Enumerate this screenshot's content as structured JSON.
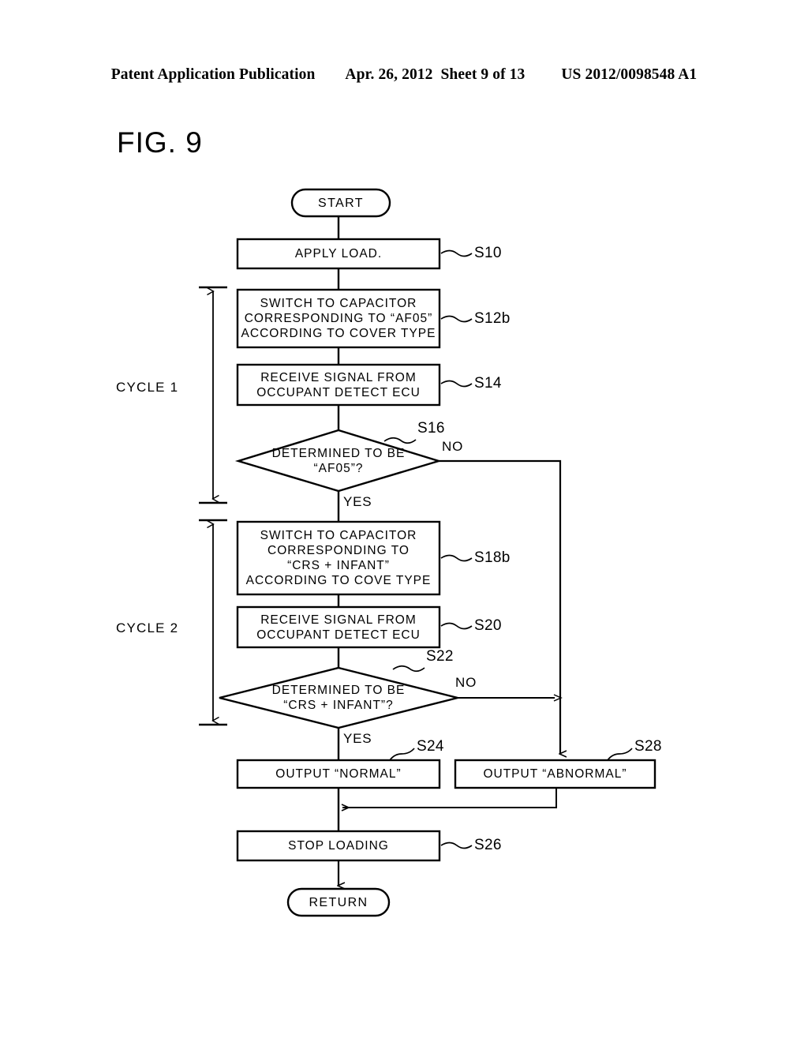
{
  "header": {
    "left": "Patent Application Publication",
    "middle": "Apr. 26, 2012  Sheet 9 of 13",
    "right": "US 2012/0098548 A1"
  },
  "figure": {
    "label": "FIG. 9",
    "type": "flowchart"
  },
  "diagram": {
    "nodes": [
      {
        "id": "start",
        "shape": "terminator",
        "text": "START",
        "ref": ""
      },
      {
        "id": "s10",
        "shape": "process",
        "text": "APPLY LOAD.",
        "ref": "S10"
      },
      {
        "id": "s12b",
        "shape": "process",
        "text": "SWITCH TO CAPACITOR\nCORRESPONDING TO “AF05”\nACCORDING TO COVER TYPE",
        "ref": "S12b"
      },
      {
        "id": "s14",
        "shape": "process",
        "text": "RECEIVE SIGNAL FROM\nOCCUPANT DETECT ECU",
        "ref": "S14"
      },
      {
        "id": "s16",
        "shape": "decision",
        "text": "DETERMINED TO BE\n“AF05”?",
        "ref": "S16"
      },
      {
        "id": "s18b",
        "shape": "process",
        "text": "SWITCH TO CAPACITOR\nCORRESPONDING TO\n“CRS + INFANT”\nACCORDING TO COVE TYPE",
        "ref": "S18b"
      },
      {
        "id": "s20",
        "shape": "process",
        "text": "RECEIVE SIGNAL FROM\nOCCUPANT DETECT ECU",
        "ref": "S20"
      },
      {
        "id": "s22",
        "shape": "decision",
        "text": "DETERMINED TO BE\n“CRS + INFANT”?",
        "ref": "S22"
      },
      {
        "id": "s24",
        "shape": "process",
        "text": "OUTPUT “NORMAL”",
        "ref": "S24"
      },
      {
        "id": "s28",
        "shape": "process",
        "text": "OUTPUT “ABNORMAL”",
        "ref": "S28"
      },
      {
        "id": "s26",
        "shape": "process",
        "text": "STOP LOADING",
        "ref": "S26"
      },
      {
        "id": "return",
        "shape": "terminator",
        "text": "RETURN",
        "ref": ""
      }
    ],
    "branch_labels": {
      "s16_no": "NO",
      "s16_yes": "YES",
      "s22_no": "NO",
      "s22_yes": "YES"
    },
    "brackets": [
      {
        "id": "cycle1",
        "label": "CYCLE 1"
      },
      {
        "id": "cycle2",
        "label": "CYCLE 2"
      }
    ]
  }
}
